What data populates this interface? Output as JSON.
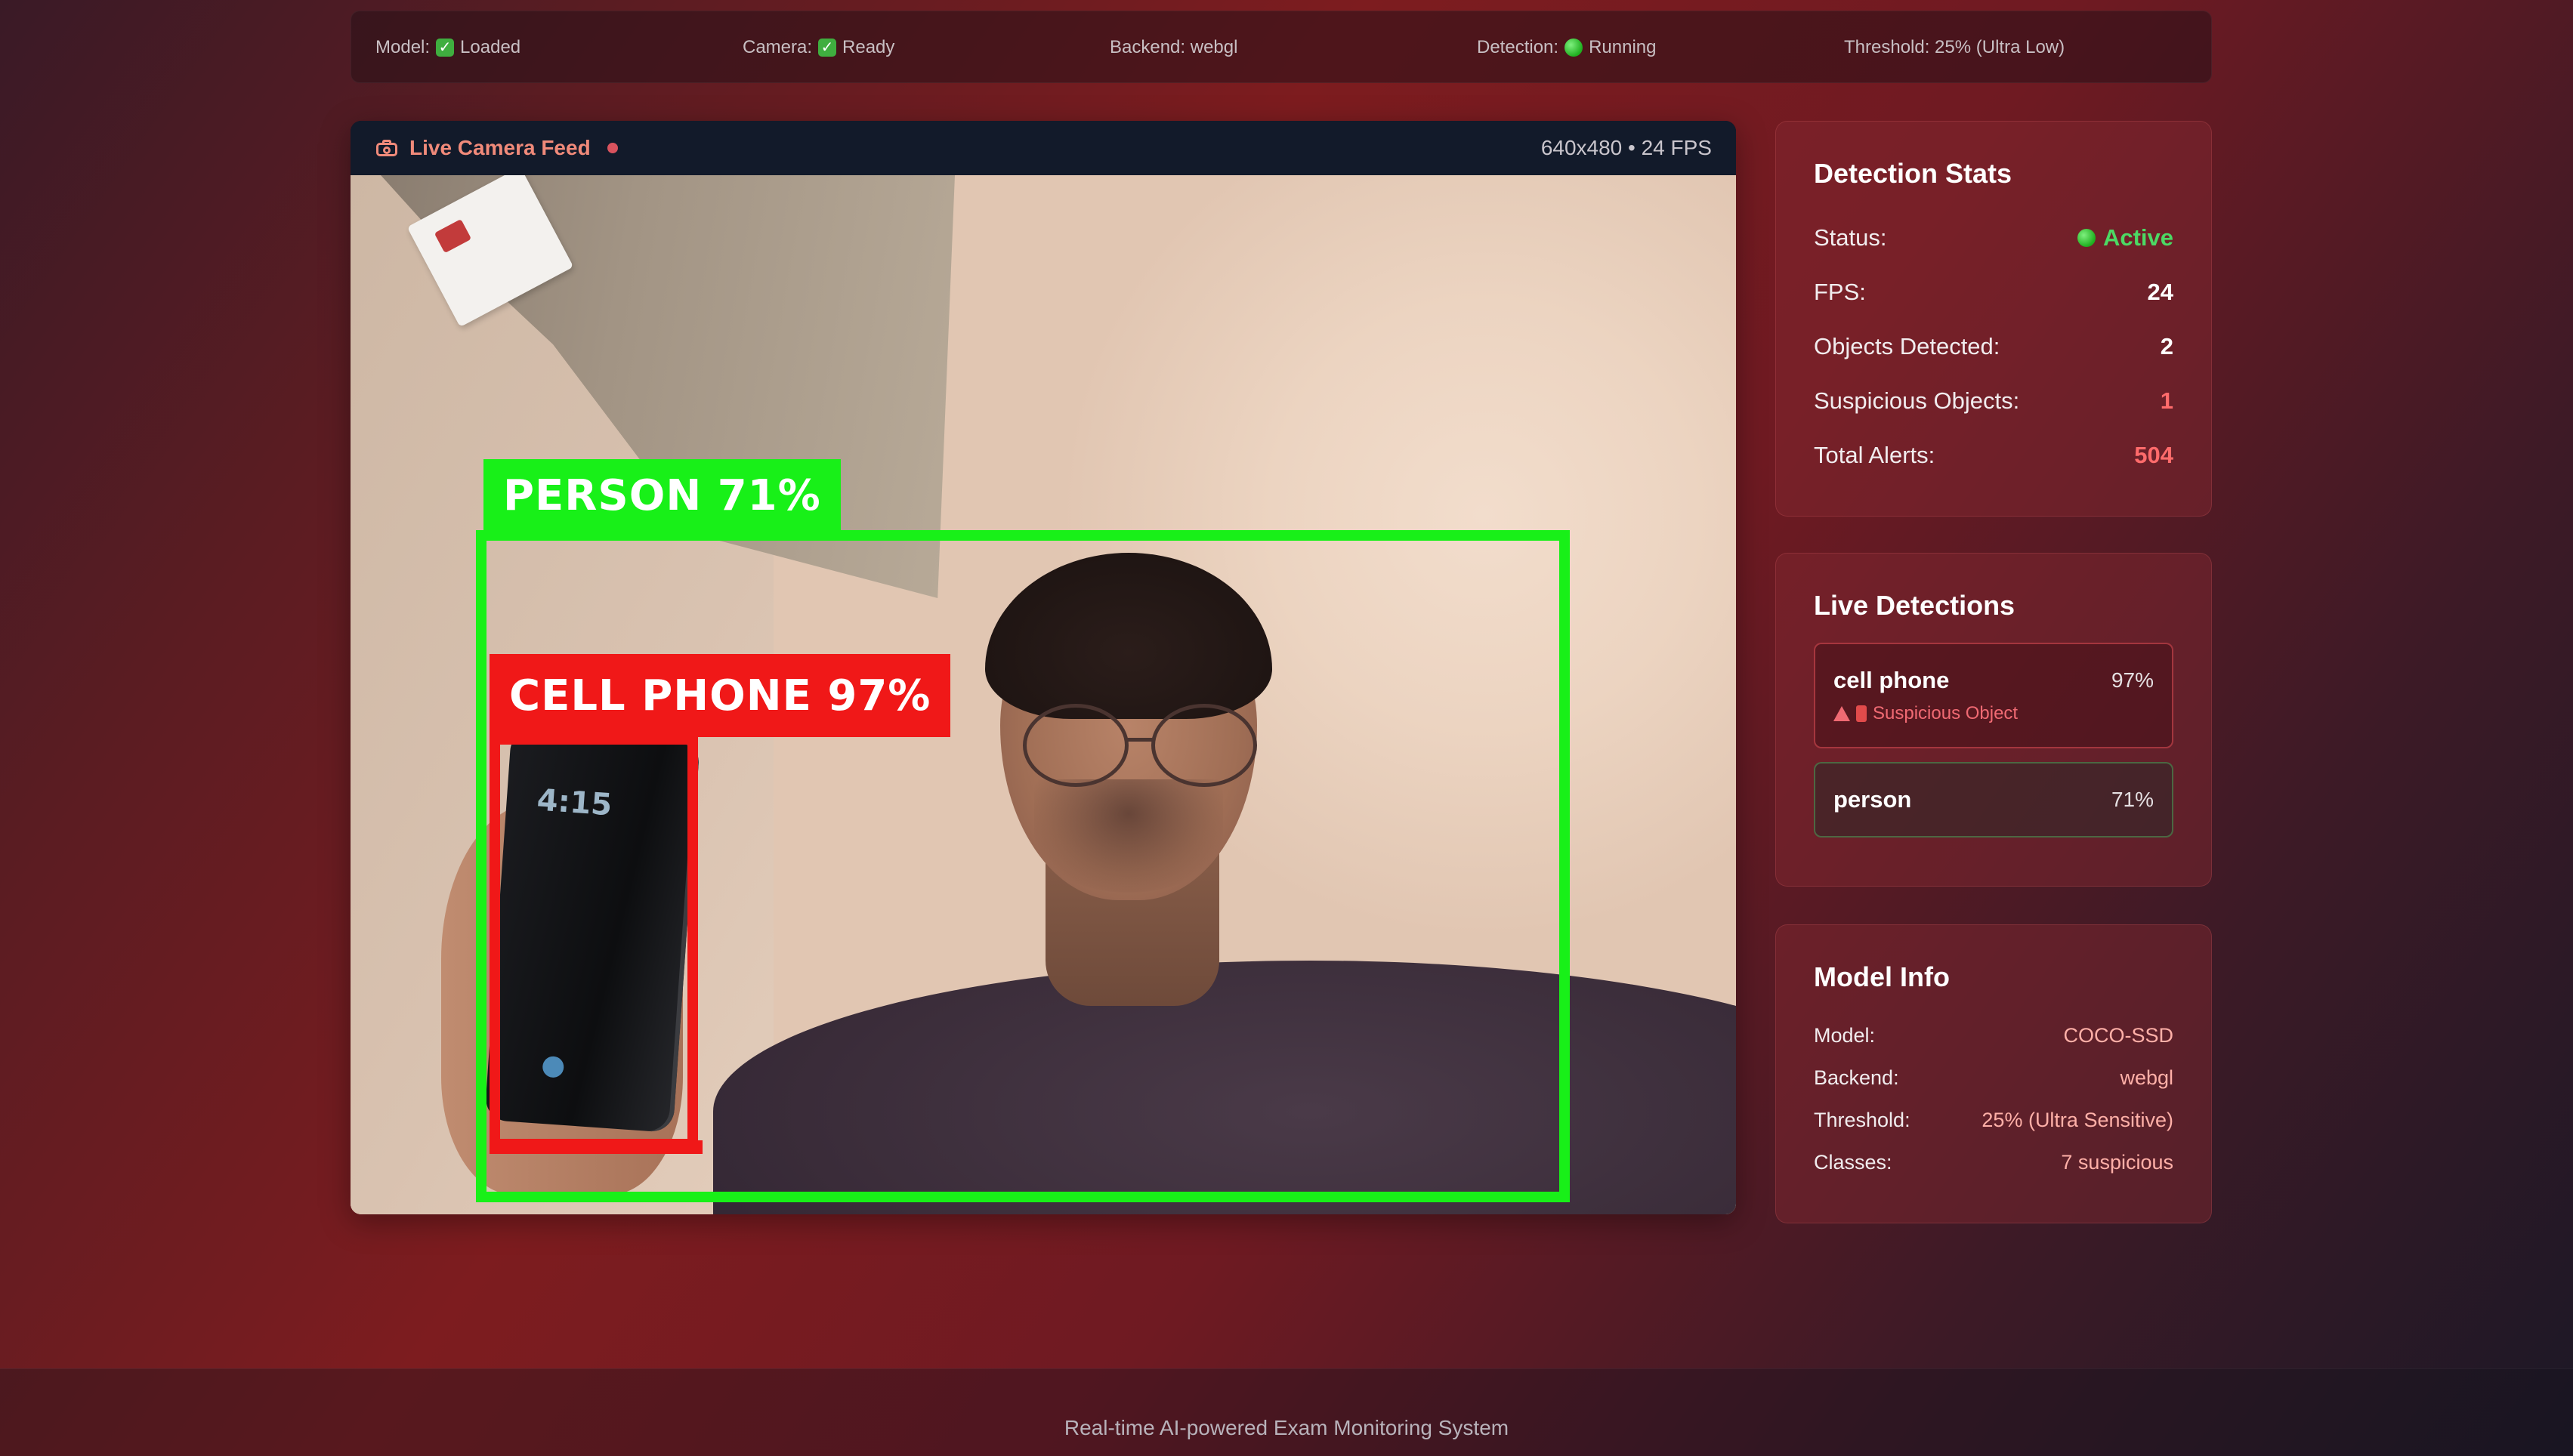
{
  "statusbar": {
    "model_label": "Model:",
    "model_value": "Loaded",
    "camera_label": "Camera:",
    "camera_value": "Ready",
    "backend_text": "Backend: webgl",
    "detection_label": "Detection:",
    "detection_value": "Running",
    "threshold_text": "Threshold: 25% (Ultra Low)"
  },
  "camera": {
    "title": "Live Camera Feed",
    "resolution_fps": "640x480 • 24 FPS",
    "phone_time": "4:15",
    "boxes": [
      {
        "label": "PERSON 71%",
        "color": "#18f018"
      },
      {
        "label": "CELL PHONE 97%",
        "color": "#f01818"
      }
    ]
  },
  "stats": {
    "title": "Detection Stats",
    "rows": [
      {
        "label": "Status:",
        "value": "Active"
      },
      {
        "label": "FPS:",
        "value": "24"
      },
      {
        "label": "Objects Detected:",
        "value": "2"
      },
      {
        "label": "Suspicious Objects:",
        "value": "1"
      },
      {
        "label": "Total Alerts:",
        "value": "504"
      }
    ]
  },
  "live": {
    "title": "Live Detections",
    "items": [
      {
        "name": "cell phone",
        "pct": "97%",
        "warning": "Suspicious Object"
      },
      {
        "name": "person",
        "pct": "71%"
      }
    ]
  },
  "model": {
    "title": "Model Info",
    "rows": [
      {
        "label": "Model:",
        "value": "COCO-SSD"
      },
      {
        "label": "Backend:",
        "value": "webgl"
      },
      {
        "label": "Threshold:",
        "value": "25% (Ultra Sensitive)"
      },
      {
        "label": "Classes:",
        "value": "7 suspicious"
      }
    ]
  },
  "footer": {
    "text": "Real-time AI-powered Exam Monitoring System"
  },
  "colors": {
    "active_green": "#4cd964",
    "alert_red": "#ff6b6b",
    "person_box": "#18f018",
    "phone_box": "#f01818"
  }
}
